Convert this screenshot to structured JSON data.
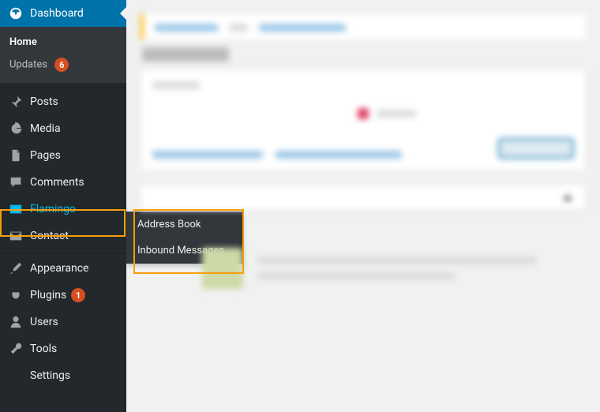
{
  "sidebar": {
    "items": [
      {
        "label": "Dashboard"
      },
      {
        "label": "Home"
      },
      {
        "label": "Updates",
        "badge": "6"
      },
      {
        "label": "Posts"
      },
      {
        "label": "Media"
      },
      {
        "label": "Pages"
      },
      {
        "label": "Comments"
      },
      {
        "label": "Flamingo"
      },
      {
        "label": "Contact"
      },
      {
        "label": "Appearance"
      },
      {
        "label": "Plugins",
        "badge": "1"
      },
      {
        "label": "Users"
      },
      {
        "label": "Tools"
      },
      {
        "label": "Settings"
      }
    ]
  },
  "flyout": {
    "items": [
      {
        "label": "Address Book"
      },
      {
        "label": "Inbound Messages"
      }
    ]
  }
}
